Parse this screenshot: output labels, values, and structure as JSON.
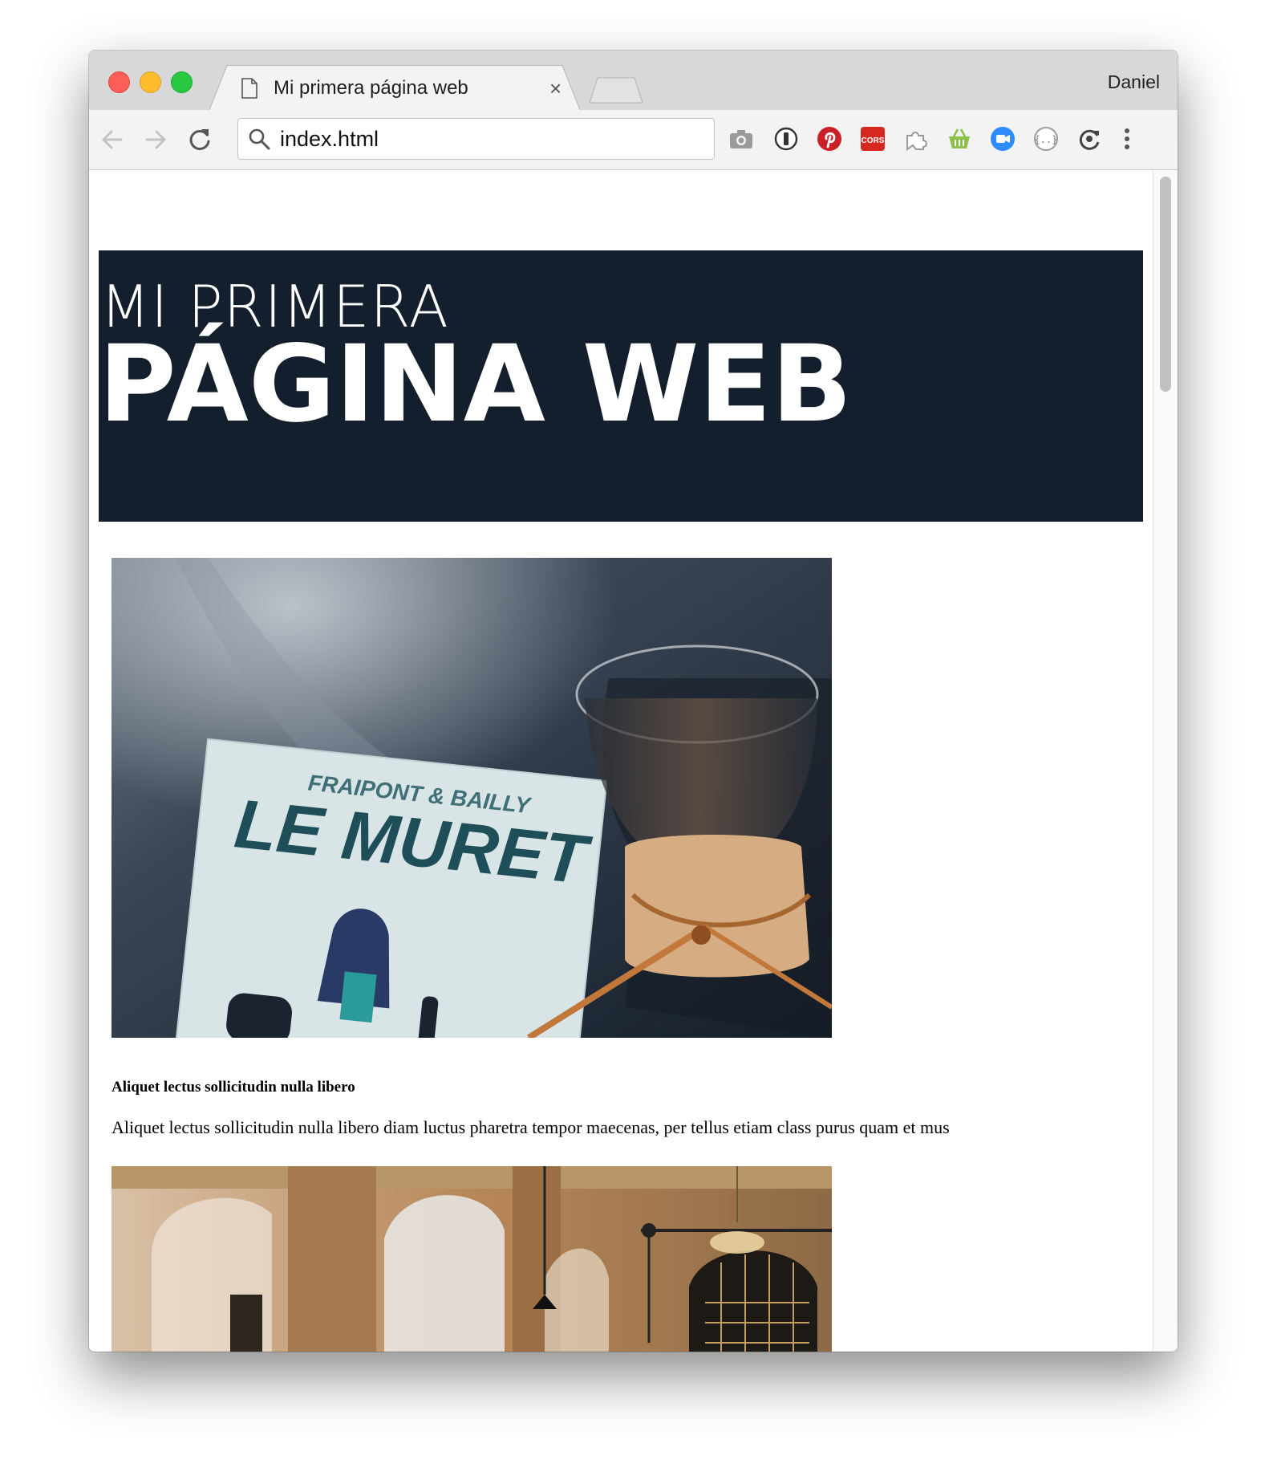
{
  "browser": {
    "tab_title": "Mi primera página web",
    "tab_close_label": "×",
    "profile_name": "Daniel",
    "address": "index.html",
    "extensions": [
      "camera-icon",
      "1password-icon",
      "pinterest-icon",
      "cors-icon",
      "puzzle-icon",
      "basket-icon",
      "zoom-video-icon",
      "json-viewer-icon",
      "sync-icon",
      "menu-icon"
    ],
    "cors_label": "CORS"
  },
  "page": {
    "hero_line1": "MI PRIMERA",
    "hero_line2": "PÁGINA WEB",
    "photo1_book_author": "FRAIPONT & BAILLY",
    "photo1_book_title": "LE MURET",
    "section_heading": "Aliquet lectus sollicitudin nulla libero",
    "section_text": "Aliquet lectus sollicitudin nulla libero diam luctus pharetra tempor maecenas, per tellus etiam class purus quam et mus"
  },
  "colors": {
    "hero_background": "#141f2d",
    "close": "#fc5f57",
    "minimize": "#fdbc2e",
    "maximize": "#28c840"
  }
}
